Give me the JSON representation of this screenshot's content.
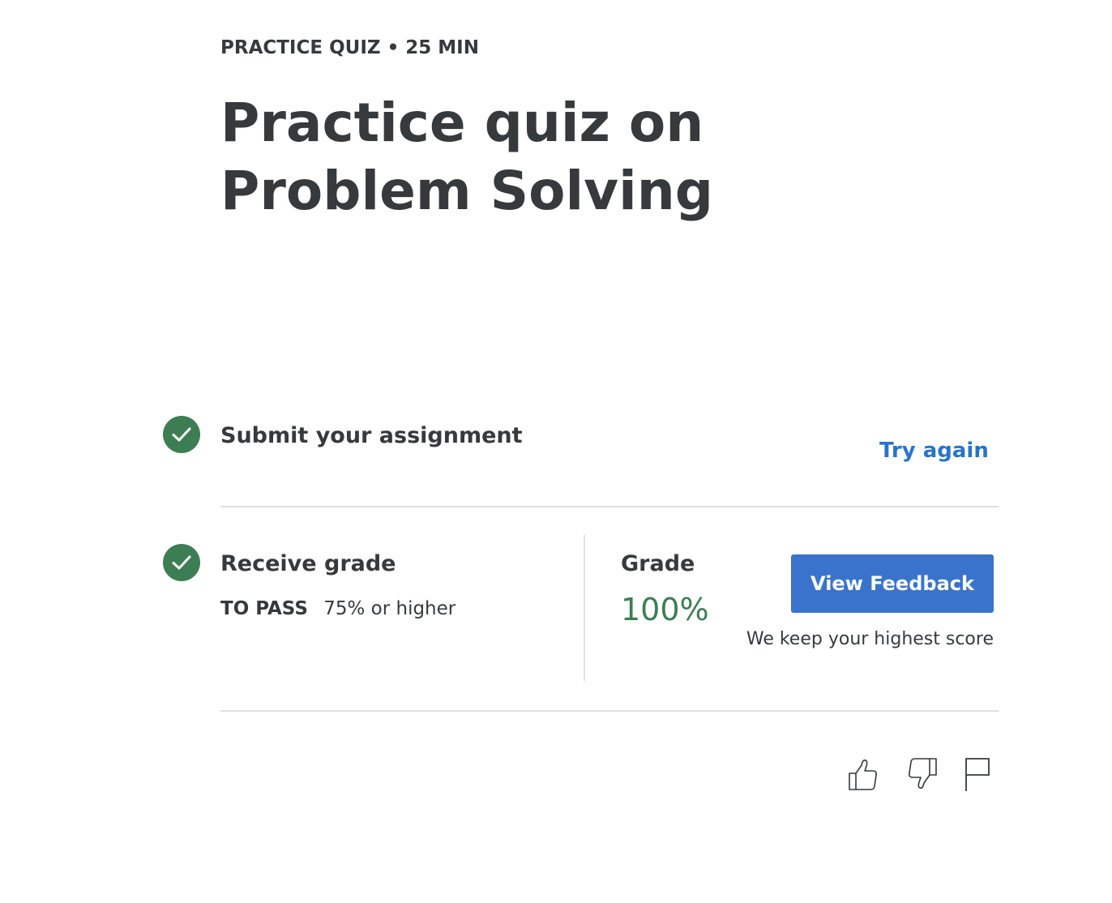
{
  "header": {
    "eyebrow": "PRACTICE QUIZ • 25 MIN",
    "title": "Practice quiz on Problem Solving"
  },
  "submit_step": {
    "title": "Submit your assignment",
    "action_label": "Try again",
    "completed": true
  },
  "grade_step": {
    "title": "Receive grade",
    "to_pass_label": "TO PASS",
    "to_pass_value": "75% or higher",
    "grade_label": "Grade",
    "grade_value": "100%",
    "feedback_button": "View Feedback",
    "keep_note": "We keep your highest score",
    "completed": true
  },
  "actions": {
    "icons": [
      "thumbs-up-icon",
      "thumbs-down-icon",
      "flag-icon"
    ]
  },
  "colors": {
    "accent_blue": "#3a73cb",
    "success_green": "#3d7d54",
    "text": "#373a3c",
    "divider": "#dfe1e3"
  }
}
